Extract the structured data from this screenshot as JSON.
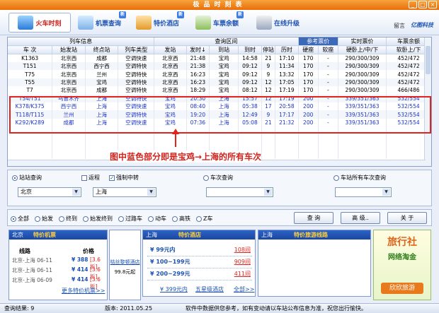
{
  "window": {
    "title": "极品时刻表"
  },
  "toolbar": {
    "items": [
      {
        "label": "火车时刻"
      },
      {
        "label": "机票查询",
        "badge": "新"
      },
      {
        "label": "特价酒店",
        "badge": "新"
      },
      {
        "label": "车票余额",
        "badge": "新"
      },
      {
        "label": "在线升级"
      }
    ],
    "feedback": "留言",
    "brand": "亿图科技"
  },
  "grid": {
    "group_headers": [
      "列车信息",
      "查询区间",
      "参考票价",
      "实时票价",
      "车票余额"
    ],
    "columns": [
      "车 次",
      "始发站",
      "终点站",
      "列车类型",
      "发站",
      "发时↓",
      "到站",
      "到时",
      "停站",
      "历时",
      "硬座",
      "软座",
      "硬卧上/中/下",
      "软卧上/下"
    ],
    "rows": [
      [
        "K1363",
        "北京西",
        "成都",
        "空调快速",
        "北京西",
        "21:48",
        "宝鸡",
        "14:58",
        "21",
        "17:10",
        "170",
        "-",
        "290/300/309",
        "452/472"
      ],
      [
        "T151",
        "北京西",
        "西宁西",
        "空调特快",
        "北京西",
        "21:38",
        "宝鸡",
        "09:12",
        "9",
        "11:34",
        "170",
        "-",
        "290/300/309",
        "452/472"
      ],
      [
        "T75",
        "北京西",
        "兰州",
        "空调特快",
        "北京西",
        "16:23",
        "宝鸡",
        "09:12",
        "9",
        "13:32",
        "170",
        "-",
        "290/300/309",
        "452/472"
      ],
      [
        "T55",
        "北京西",
        "宝鸡",
        "空调特快",
        "北京西",
        "16:23",
        "宝鸡",
        "09:12",
        "12",
        "17:05",
        "170",
        "-",
        "290/300/309",
        "452/472"
      ],
      [
        "T7",
        "北京西",
        "成都",
        "空调特快",
        "北京西",
        "18:29",
        "宝鸡",
        "08:12",
        "12",
        "17:19",
        "170",
        "-",
        "290/300/309",
        "466/486"
      ],
      [
        "T54/T51",
        "乌鲁木齐",
        "上海",
        "空调特快",
        "宝鸡",
        "20:30",
        "上海",
        "15:57",
        "12",
        "17:19",
        "200",
        "-",
        "339/351/363",
        "532/554"
      ],
      [
        "K378/K375",
        "西宁西",
        "上海",
        "空调快速",
        "宝鸡",
        "08:40",
        "上海",
        "05:38",
        "17",
        "20:58",
        "200",
        "-",
        "339/351/363",
        "532/554"
      ],
      [
        "T118/T115",
        "兰州",
        "上海",
        "空调特快",
        "宝鸡",
        "19:20",
        "上海",
        "12:49",
        "9",
        "17:17",
        "200",
        "-",
        "339/351/363",
        "532/554"
      ],
      [
        "K292/K289",
        "成都",
        "上海",
        "空调快速",
        "宝鸡",
        "07:36",
        "上海",
        "05:08",
        "21",
        "21:32",
        "200",
        "-",
        "339/351/363",
        "532/554"
      ]
    ],
    "annotation": "图中蓝色部分即是宝鸡→上海的所有车次"
  },
  "search": {
    "station_query": "站站查询",
    "via_label": "返程",
    "force_transfer_label": "强制中转",
    "from_value": "北京",
    "to_value": "上海",
    "train_query": "车次查询",
    "all_trains_query": "车站所有车次查询"
  },
  "filters": {
    "options": [
      "全部",
      "始发",
      "终到",
      "始发终到",
      "过路车",
      "动车",
      "高铁",
      "Z车"
    ],
    "query_button": "查 询",
    "advanced_button": "高 级..",
    "about_button": "关 于"
  },
  "ads": {
    "flight": {
      "city": "北京",
      "title": "特价机票",
      "col_route": "线路",
      "col_price": "价格",
      "rows": [
        {
          "route": "北京-上海 06-11",
          "price": "¥ 388",
          "discount": "[3.6折]"
        },
        {
          "route": "北京-上海 06-11",
          "price": "¥ 414",
          "discount": "[3.6折]"
        },
        {
          "route": "北京-上海 06-09",
          "price": "¥ 414",
          "discount": "[3.6折]"
        }
      ],
      "more": "更多特价机票>>"
    },
    "hotel_promo": {
      "line1": "桔丝黎顿酒店",
      "line2": "99.8元起"
    },
    "hotel": {
      "city": "上海",
      "title": "特价酒店",
      "rows": [
        {
          "range": "¥ 99元内",
          "count": "108间"
        },
        {
          "range": "¥ 100~199元",
          "count": "909间"
        },
        {
          "range": "¥ 200~299元",
          "count": "411间"
        }
      ],
      "link1": "¥ 399元内",
      "link2": "五星级酒店",
      "more": "全部>>"
    },
    "tour": {
      "city": "上海",
      "title": "特价旅游线路"
    },
    "travel": {
      "line1": "旅行社",
      "line2": "网络淘金",
      "line3": "欣欣旅游"
    }
  },
  "status": {
    "result": "查询结果: 9",
    "version": "版本: 2011.05.25",
    "notice": "软件中数据供您参考，如有变动请以车站公布信息为准，祝您出行愉快。"
  },
  "colors": {
    "accent": "#1d52b4",
    "highlight": "#e0231d",
    "blue_rows": "#1a33c8"
  }
}
